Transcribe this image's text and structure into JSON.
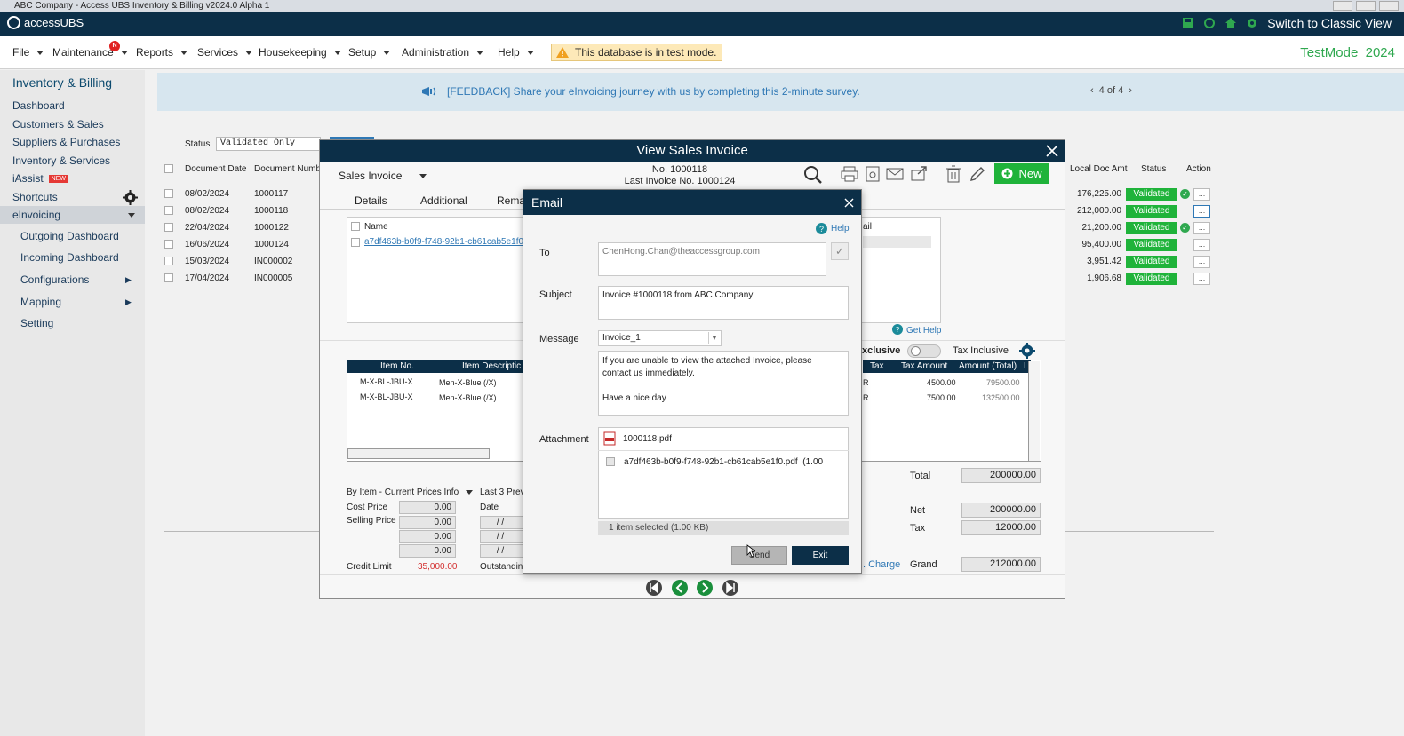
{
  "window_title": "ABC Company - Access UBS Inventory & Billing v2024.0 Alpha 1",
  "app": {
    "logo": "accessUBS",
    "switch_label": "Switch to Classic View"
  },
  "menu": {
    "items": [
      "File",
      "Maintenance",
      "Reports",
      "Services",
      "Housekeeping",
      "Setup",
      "Administration",
      "Help"
    ],
    "maintenance_badge": "N",
    "test_mode_notice": "This database is in test mode.",
    "db_name": "TestMode_2024"
  },
  "sidebar": {
    "title": "Inventory & Billing",
    "items": [
      "Dashboard",
      "Customers & Sales",
      "Suppliers & Purchases",
      "Inventory & Services",
      "iAssist",
      "Shortcuts",
      "eInvoicing"
    ],
    "iassist_badge": "NEW",
    "sub_items": [
      "Outgoing Dashboard",
      "Incoming Dashboard",
      "Configurations",
      "Mapping",
      "Setting"
    ]
  },
  "feedback": {
    "message": "[FEEDBACK] Share your eInvoicing journey with us by completing this 2-minute survey.",
    "pager": "4 of 4"
  },
  "list": {
    "status_label": "Status",
    "status_value": "Validated Only",
    "columns": {
      "date": "Document Date",
      "number": "Document Number",
      "amount": "Local Doc Amt",
      "status": "Status",
      "action": "Action"
    },
    "rows": [
      {
        "date": "08/02/2024",
        "number": "1000117",
        "amount": "176,225.00",
        "status": "Validated"
      },
      {
        "date": "08/02/2024",
        "number": "1000118",
        "amount": "212,000.00",
        "status": "Validated"
      },
      {
        "date": "22/04/2024",
        "number": "1000122",
        "amount": "21,200.00",
        "status": "Validated"
      },
      {
        "date": "16/06/2024",
        "number": "1000124",
        "amount": "95,400.00",
        "status": "Validated"
      },
      {
        "date": "15/03/2024",
        "number": "IN000002",
        "amount": "3,951.42",
        "status": "Validated"
      },
      {
        "date": "17/04/2024",
        "number": "IN000005",
        "amount": "1,906.68",
        "status": "Validated"
      }
    ],
    "action_dots": "..."
  },
  "invoice": {
    "title": "View Sales Invoice",
    "doc_type": "Sales Invoice",
    "number": "No. 1000118",
    "last_invoice": "Last Invoice No. 1000124",
    "new_button": "New",
    "tabs": [
      "Details",
      "Additional",
      "Rema"
    ],
    "attach_col_name": "Name",
    "attach_col_email": "ail",
    "attach_file": "a7df463b-b0f9-f748-92b1-cb61cab5e1f0.pdf",
    "get_help": "Get Help",
    "tax_exclusive": "xclusive",
    "tax_inclusive": "Tax Inclusive",
    "grid_headers_left": [
      "Item No.",
      "Item Descriptic"
    ],
    "grid_headers_right": [
      "Tax",
      "Tax Amount",
      "Amount (Total)",
      "L"
    ],
    "grid_rows": [
      {
        "item": "M-X-BL-JBU-X",
        "desc": "Men-X-Blue (/X)",
        "tax": "R",
        "tax_amount": "4500.00",
        "amount": "79500.00"
      },
      {
        "item": "M-X-BL-JBU-X",
        "desc": "Men-X-Blue (/X)",
        "tax": "R",
        "tax_amount": "7500.00",
        "amount": "132500.00"
      }
    ],
    "price_info_label": "By Item - Current Prices Info",
    "last3_label": "Last 3 Previ",
    "date_label": "Date",
    "cost_price_label": "Cost Price",
    "cost_price": "0.00",
    "selling_price_label": "Selling Price",
    "selling_prices": [
      "0.00",
      "0.00",
      "0.00"
    ],
    "date_slashes": "/   /",
    "credit_limit_label": "Credit Limit",
    "credit_limit": "35,000.00",
    "outstanding_label": "Outstanding",
    "total_label": "Total",
    "total": "200000.00",
    "net_label": "Net",
    "net": "200000.00",
    "tax_label": "Tax",
    "tax": "12000.00",
    "charge_label": ". Charge",
    "grand_label": "Grand",
    "grand": "212000.00"
  },
  "email": {
    "title": "Email",
    "help": "Help",
    "to_label": "To",
    "to_value": "ChenHong.Chan@theaccessgroup.com",
    "subject_label": "Subject",
    "subject_value": "Invoice #1000118 from ABC Company",
    "message_label": "Message",
    "template": "Invoice_1",
    "message_line1": "If you are unable to view the attached Invoice, please",
    "message_line2": "contact us immediately.",
    "message_line3": "Have a nice day",
    "attachment_label": "Attachment",
    "attachment_main": "1000118.pdf",
    "attachment_extra": "a7df463b-b0f9-f748-92b1-cb61cab5e1f0.pdf",
    "attachment_extra_size": "(1.00",
    "selection_info": "1 item selected  (1.00 KB)",
    "send_button": "Send",
    "exit_button": "Exit"
  },
  "colors": {
    "navy": "#0c2f48",
    "accent_green": "#1fb33a",
    "link_blue": "#2f78b5"
  }
}
